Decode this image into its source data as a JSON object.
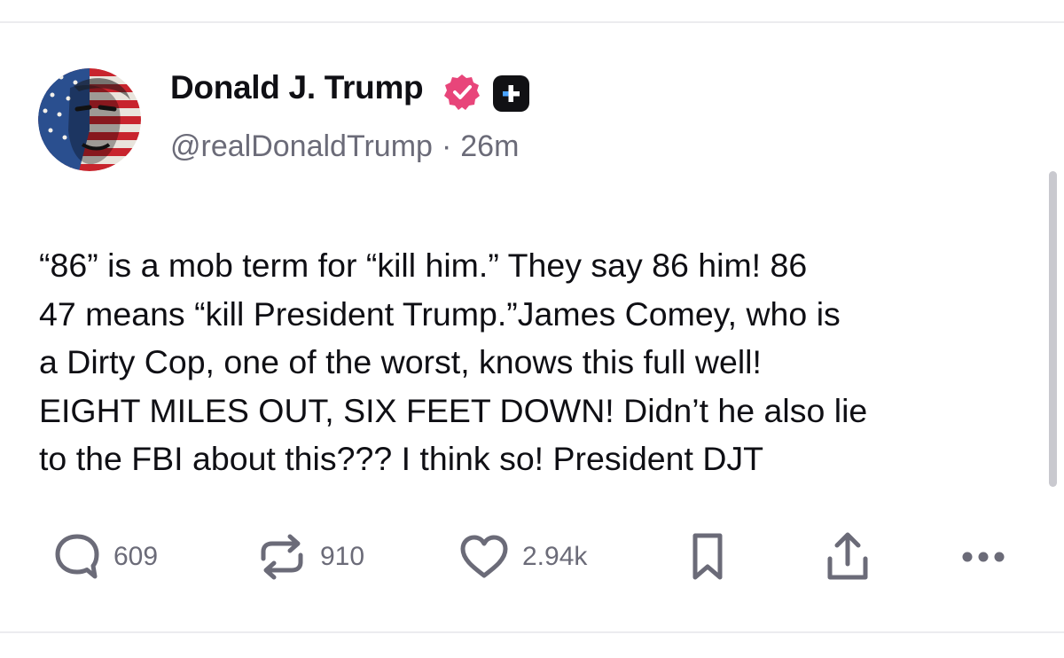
{
  "post": {
    "author": {
      "display_name": "Donald J. Trump",
      "handle": "@realDonaldTrump",
      "verified_icon": "verified-badge-icon",
      "plus_badge_icon": "plus-square-icon"
    },
    "separator": "·",
    "timestamp": "26m",
    "body_lines": [
      "“86” is a mob term for “kill him.” They say 86 him! 86",
      "47 means “kill President Trump.”James Comey, who is",
      "a Dirty Cop, one of the worst, knows this full well!",
      "EIGHT MILES OUT, SIX FEET DOWN! Didn’t he also lie",
      "to the FBI about this??? I think so! President DJT"
    ],
    "actions": {
      "replies": {
        "icon": "reply-bubble-icon",
        "count": "609"
      },
      "reposts": {
        "icon": "repost-icon",
        "count": "910"
      },
      "likes": {
        "icon": "heart-icon",
        "count": "2.94k"
      },
      "bookmark": {
        "icon": "bookmark-icon"
      },
      "share": {
        "icon": "share-icon"
      },
      "more": {
        "icon": "more-dots-icon"
      }
    }
  },
  "colors": {
    "text_primary": "#0f0f14",
    "text_secondary": "#6b6b78",
    "verified_badge": "#e8457a",
    "plus_badge": "#111114",
    "divider": "#ececef"
  }
}
